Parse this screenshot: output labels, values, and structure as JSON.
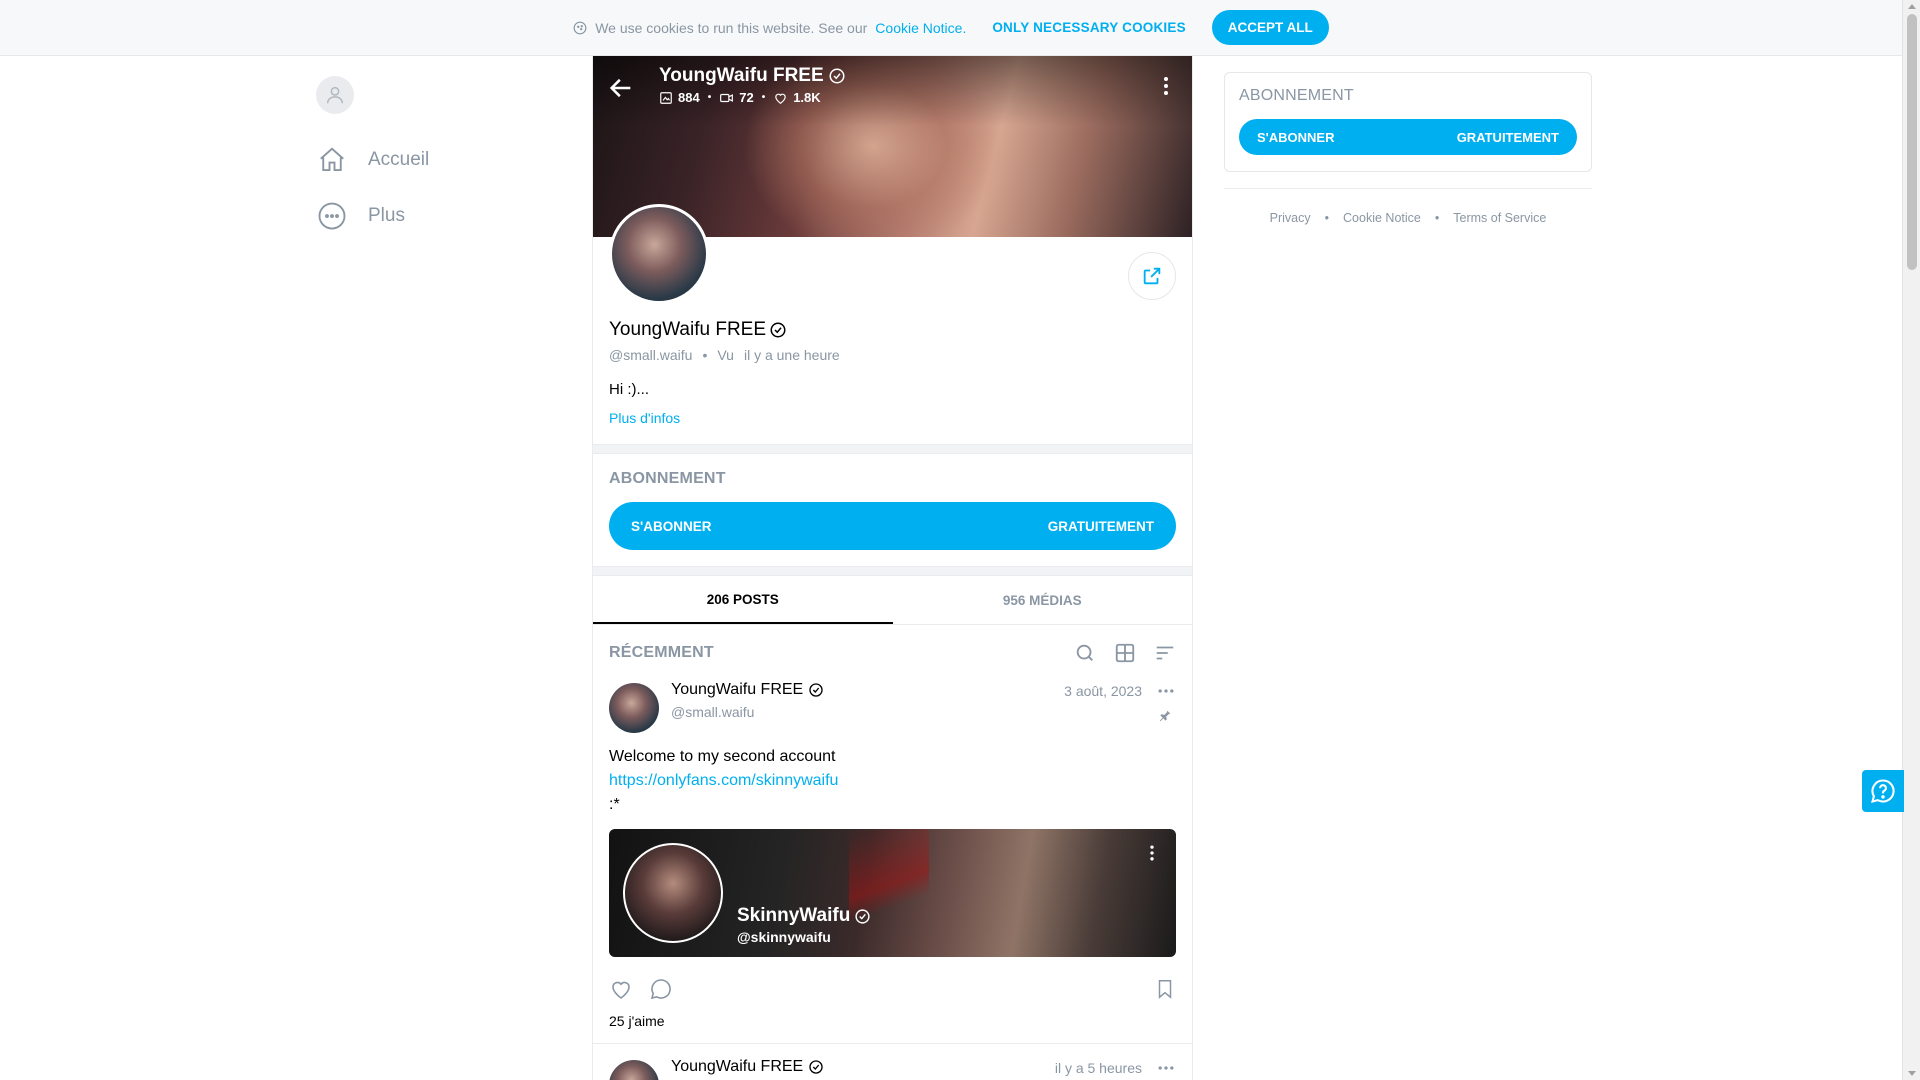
{
  "cookie_bar": {
    "text": "We use cookies to run this website. See our",
    "link": "Cookie Notice",
    "period": ".",
    "necessary_label": "ONLY NECESSARY COOKIES",
    "accept_label": "ACCEPT ALL"
  },
  "sidebar": {
    "items": [
      {
        "label": "Accueil",
        "icon": "home-icon"
      },
      {
        "label": "Plus",
        "icon": "more-circle-icon"
      }
    ]
  },
  "cover": {
    "name": "YoungWaifu FREE",
    "stats": {
      "photos": "884",
      "videos": "72",
      "likes": "1.8K"
    }
  },
  "profile": {
    "name": "YoungWaifu FREE",
    "handle": "@small.waifu",
    "seen_label": "Vu",
    "seen_time": "il y a une heure",
    "bio": "Hi :)...",
    "more_info": "Plus d'infos"
  },
  "subscription": {
    "title": "ABONNEMENT",
    "subscribe_label": "S'ABONNER",
    "price_label": "GRATUITEMENT"
  },
  "tabs": [
    {
      "label": "206 POSTS",
      "active": true
    },
    {
      "label": "956 MÉDIAS",
      "active": false
    }
  ],
  "feed": {
    "section_label": "RÉCEMMENT"
  },
  "posts": [
    {
      "name": "YoungWaifu FREE",
      "handle": "@small.waifu",
      "date": "3 août, 2023",
      "text_line1": "Welcome to my second account",
      "link": "https://onlyfans.com/skinnywaifu",
      "text_line3": ":*",
      "card": {
        "name": "SkinnyWaifu",
        "handle": "@skinnywaifu"
      },
      "likes": "25 j'aime"
    },
    {
      "name": "YoungWaifu FREE",
      "date": "il y a 5 heures"
    }
  ],
  "right": {
    "title": "ABONNEMENT",
    "subscribe_label": "S'ABONNER",
    "price_label": "GRATUITEMENT",
    "footer": [
      "Privacy",
      "Cookie Notice",
      "Terms of Service"
    ]
  },
  "colors": {
    "accent": "#00aff0",
    "muted": "#8a96a3"
  }
}
